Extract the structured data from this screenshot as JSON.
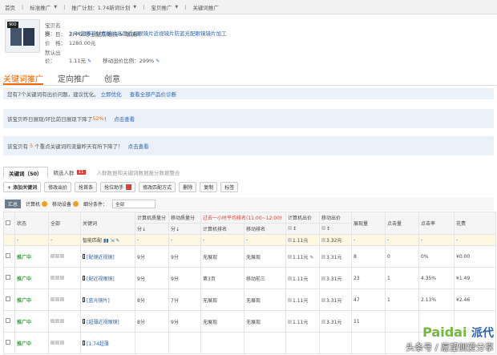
{
  "breadcrumb": [
    "首页",
    "标准推广",
    "推广计划：1.74新词计划",
    "宝贝推广",
    "关键词推广"
  ],
  "product": {
    "name_label": "宝贝名称：",
    "name": "1.74超薄非球面镜片高度近视眼镜片近视镜片防蓝光配眼镜镜片加工",
    "category_label": "类　目：",
    "category": "ZPPO/珍士配万/眼镜 > 眼镜片",
    "price_label": "价　格：",
    "price": "1280.00元",
    "default_bid_label": "默认出价：",
    "default_bid": "1.11元",
    "mobile_ratio_label": "移动出价比例：",
    "mobile_ratio": "299%",
    "image_badge": "900"
  },
  "main_tabs": [
    "关键词推广",
    "定向推广",
    "创意"
  ],
  "notices": [
    {
      "text": "您有7个关键词有出价问题，建议优化。",
      "link1": "立即优化",
      "link2": "查看全部产品价诊断"
    },
    {
      "text": "该宝贝昨日展现/环比前日展现下降了",
      "highlight": "52%",
      "after": "！",
      "link": "点击查看"
    },
    {
      "prefix": "该宝贝有",
      "highlight": "5",
      "text": "个重点关键词的流量昨天有所下降了！",
      "link": "点击查看"
    }
  ],
  "sub_tabs": {
    "keywords": "关键词（50）",
    "crowd": "精选人群",
    "crowd_count": "11",
    "hint": "人群数据和关键词数据报分数据整合"
  },
  "toolbar": {
    "add": "+ 添加关键词",
    "edit_bid": "修改出价",
    "tag": "抢首条",
    "rank": "抢位助手",
    "match": "修改匹配方式",
    "delete": "删除",
    "copy": "复制",
    "tag2": "标签"
  },
  "filterbar": {
    "summary": "汇总",
    "pc": "计算机",
    "mobile": "移动设备",
    "filter_label": "细分条件：",
    "filter_value": "全部"
  },
  "table": {
    "headers": {
      "status": "状态",
      "all": "全部",
      "keyword": "关键词",
      "pc_quality": "计算机质量分",
      "mobile_quality": "移动质量分",
      "rank_group": "过去一小时平均排名(11:00~12:00)",
      "pc_rank": "计算机排名",
      "mobile_rank": "移动排名",
      "pc_bid": "计算机出价",
      "mobile_bid": "移动出价",
      "impressions": "展现量",
      "clicks": "点击量",
      "ctr": "点击率",
      "cost": "花费",
      "sort_down": "分↓"
    },
    "smart_row": {
      "keyword": "智能匹配",
      "pc_bid": "1.11元",
      "mobile_bid": "3.32元",
      "dash": "-"
    },
    "rows": [
      {
        "status": "推广中",
        "keyword": "[配镜近视镜]",
        "pc_q": "9分",
        "m_q": "9分",
        "pc_rank": "无展现",
        "m_rank": "无展现",
        "pc_bid": "1.11元",
        "m_bid": "3.31元",
        "impr": "8",
        "clicks": "0",
        "ctr": "0%",
        "cost": "¥0.00"
      },
      {
        "status": "推广中",
        "keyword": "[配近视眼镜]",
        "pc_q": "9分",
        "m_q": "9分",
        "pc_rank": "第3页",
        "m_rank": "移动前三",
        "pc_bid": "1.11元",
        "m_bid": "3.31元",
        "impr": "23",
        "clicks": "1",
        "ctr": "4.35%",
        "cost": "¥1.49"
      },
      {
        "status": "推广中",
        "keyword": "[蓝光镜片]",
        "pc_q": "8分",
        "m_q": "7分",
        "pc_rank": "无展现",
        "m_rank": "无展现",
        "pc_bid": "1.11元",
        "m_bid": "3.31元",
        "impr": "47",
        "clicks": "1",
        "ctr": "2.13%",
        "cost": "¥2.46"
      },
      {
        "status": "推广中",
        "keyword": "[超薄近视眼镜]",
        "pc_q": "8分",
        "m_q": "9分",
        "pc_rank": "无展现",
        "m_rank": "无展现",
        "pc_bid": "1.11元",
        "m_bid": "3.31元",
        "impr": "11",
        "clicks": "",
        "ctr": "",
        "cost": ""
      },
      {
        "status": "推广中",
        "keyword": "[1.74超薄",
        "pc_q": "",
        "m_q": "",
        "pc_rank": "",
        "m_rank": "",
        "pc_bid": "",
        "m_bid": "",
        "impr": "",
        "clicks": "",
        "ctr": "",
        "cost": ""
      }
    ]
  },
  "watermark": {
    "p": "Paidai",
    "cn": "派代",
    "sub": "头条号 / 愿望侧爱分享"
  }
}
